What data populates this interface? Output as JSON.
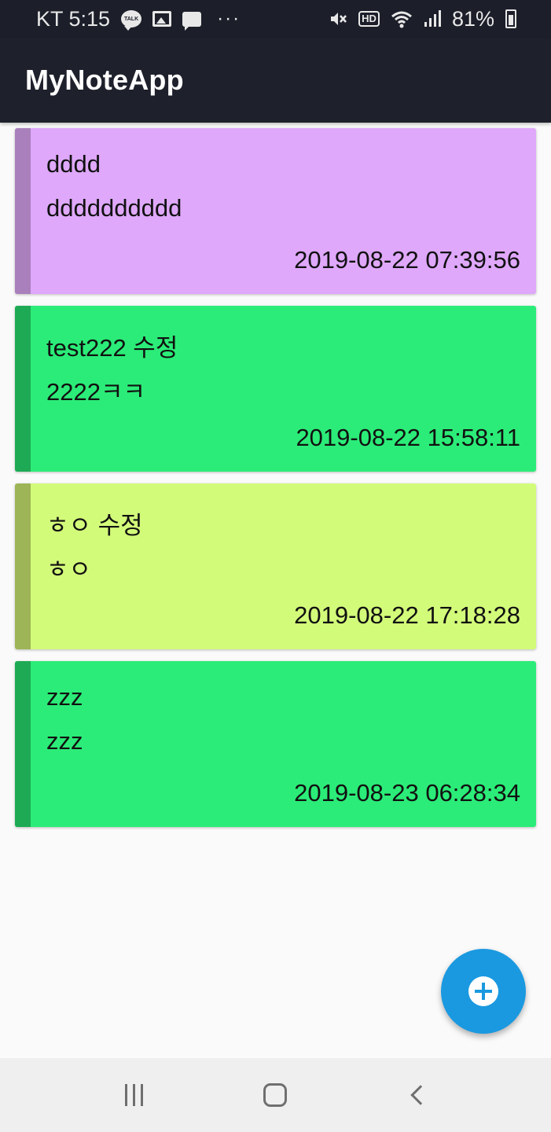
{
  "status_bar": {
    "carrier_time": "KT 5:15",
    "talk_label": "TALK",
    "more": "···",
    "hd": "HD",
    "battery_text": "81%"
  },
  "app_bar": {
    "title": "MyNoteApp"
  },
  "notes": [
    {
      "title": "dddd",
      "body": "dddddddddd",
      "date": "2019-08-22 07:39:56",
      "bg_color": "#dfa8fb",
      "stripe_color": "#a980bb"
    },
    {
      "title": "test222 수정",
      "body": "2222ㅋㅋ",
      "date": "2019-08-22 15:58:11",
      "bg_color": "#2bec78",
      "stripe_color": "#1eaa55"
    },
    {
      "title": "ㅎㅇ 수정",
      "body": "ㅎㅇ",
      "date": "2019-08-22 17:18:28",
      "bg_color": "#d3fb7a",
      "stripe_color": "#9db556"
    },
    {
      "title": "zzz",
      "body": "zzz",
      "date": "2019-08-23 06:28:34",
      "bg_color": "#2bec78",
      "stripe_color": "#1eaa55"
    }
  ],
  "fab": {
    "icon": "add-circle-icon",
    "color": "#1a99e0"
  },
  "nav_bar": {
    "recents_icon": "recents-icon",
    "home_icon": "home-icon",
    "back_icon": "back-icon"
  }
}
